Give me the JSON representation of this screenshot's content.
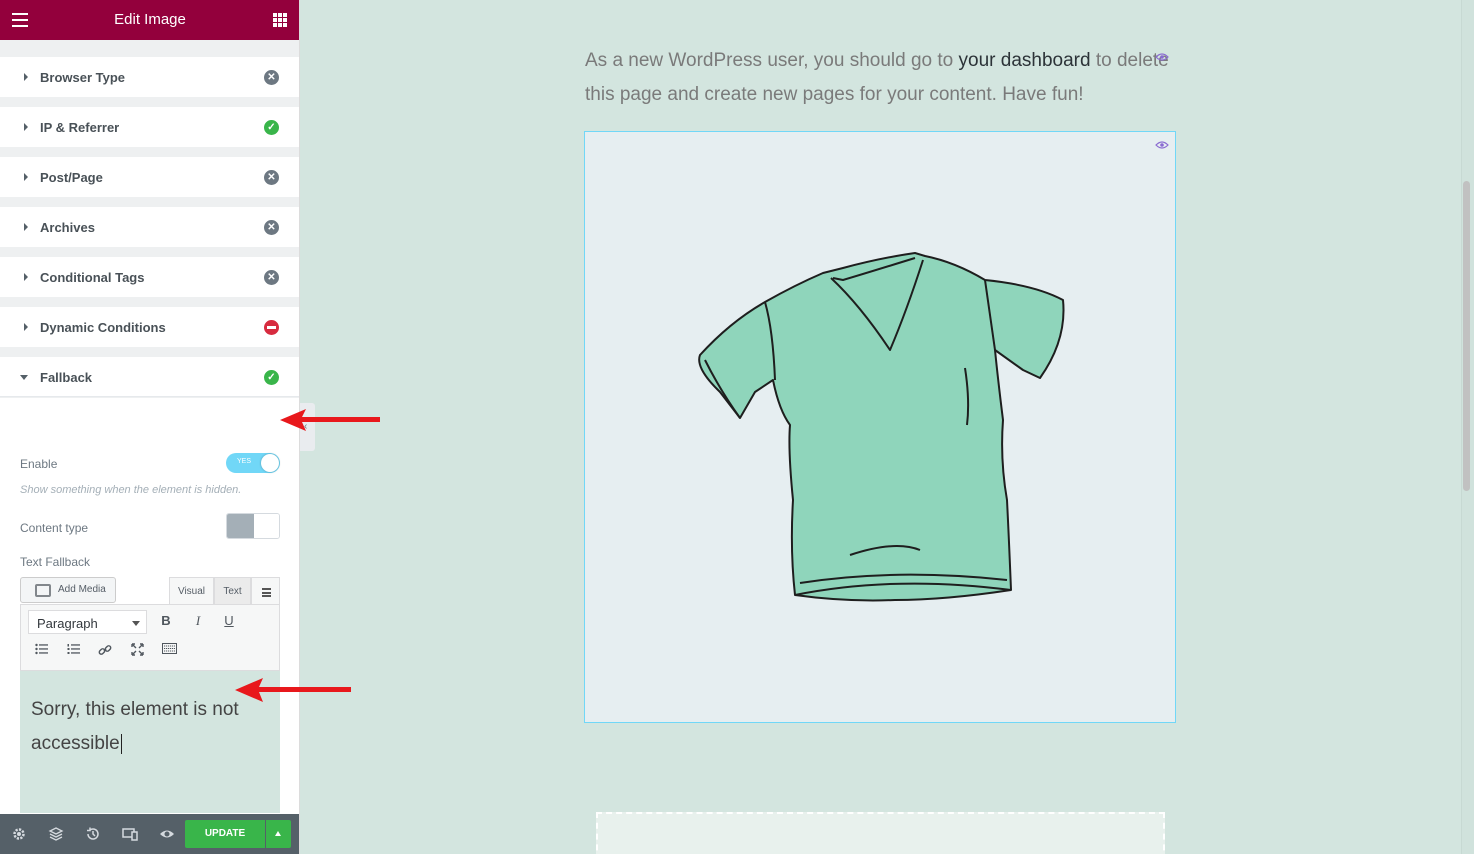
{
  "header": {
    "title": "Edit Image",
    "menu_icon": "hamburger-icon",
    "grid_icon": "apps-grid-icon"
  },
  "sections": [
    {
      "label": "Browser Type",
      "status": "off"
    },
    {
      "label": "IP & Referrer",
      "status": "on"
    },
    {
      "label": "Post/Page",
      "status": "off"
    },
    {
      "label": "Archives",
      "status": "off"
    },
    {
      "label": "Conditional Tags",
      "status": "off"
    },
    {
      "label": "Dynamic Conditions",
      "status": "blocked"
    },
    {
      "label": "Fallback",
      "status": "on"
    }
  ],
  "fallback": {
    "enable_label": "Enable",
    "enable_toggle_text": "YES",
    "enable_description": "Show something when the element is hidden.",
    "content_type_label": "Content type",
    "text_fallback_label": "Text Fallback",
    "add_media_label": "Add Media",
    "tab_visual": "Visual",
    "tab_text": "Text",
    "format_select_value": "Paragraph",
    "bold": "B",
    "italic": "I",
    "underline": "U",
    "editor_text": "Sorry, this element is not accessible"
  },
  "footer": {
    "update_label": "UPDATE"
  },
  "canvas": {
    "paragraph_before": "As a new WordPress user, you should go to ",
    "paragraph_link": "your dashboard",
    "paragraph_after": " to delete this page and create new pages for your content. Have fun!"
  },
  "colors": {
    "brand": "#93003c",
    "accent": "#71d7f7",
    "success": "#39b54a",
    "danger": "#d72b3f",
    "canvas_bg": "#d3e5df"
  }
}
